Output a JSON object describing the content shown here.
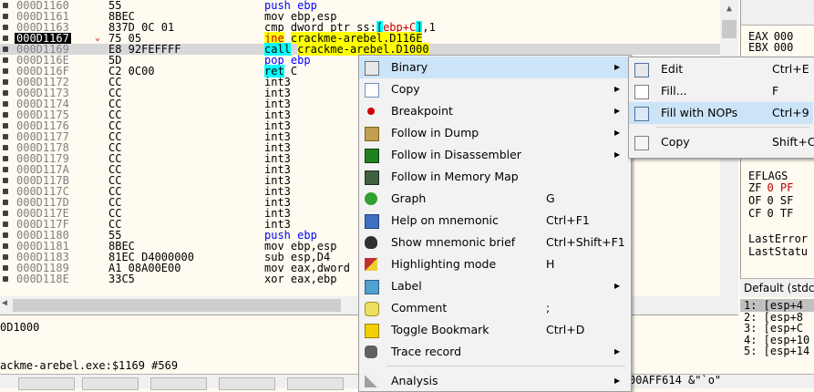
{
  "disasm": {
    "rows": [
      {
        "addr": "000D1160",
        "bytes": "55",
        "parts": [
          {
            "t": "push ebp",
            "c": "kw"
          }
        ]
      },
      {
        "addr": "000D1161",
        "bytes": "8BEC",
        "parts": [
          {
            "t": "mov ebp,esp",
            "c": ""
          }
        ]
      },
      {
        "addr": "000D1163",
        "bytes": "837D 0C 01",
        "parts": [
          {
            "t": "cmp dword ptr ss:",
            "c": ""
          },
          {
            "t": "[",
            "c": "hl-c"
          },
          {
            "t": "ebp+C",
            "c": "jmp-red"
          },
          {
            "t": "]",
            "c": "hl-c"
          },
          {
            "t": ",1",
            "c": ""
          }
        ]
      },
      {
        "addr": "000D1167",
        "bytes": "75 05",
        "parts": [
          {
            "t": "jne",
            "c": "hl-y jmp-red"
          },
          {
            "t": " ",
            "c": ""
          },
          {
            "t": "crackme-arebel.D116E",
            "c": "hl-y"
          }
        ],
        "cur": true,
        "arrow": "⌄"
      },
      {
        "addr": "000D1169",
        "bytes": "E8 92FEFFFF",
        "parts": [
          {
            "t": "call",
            "c": "hl-c"
          },
          {
            "t": " ",
            "c": ""
          },
          {
            "t": "crackme-arebel.D1000",
            "c": "hl-y"
          }
        ],
        "sel": true
      },
      {
        "addr": "000D116E",
        "bytes": "5D",
        "parts": [
          {
            "t": "pop ebp",
            "c": "kw"
          }
        ]
      },
      {
        "addr": "000D116F",
        "bytes": "C2 0C00",
        "parts": [
          {
            "t": "ret",
            "c": "hl-c"
          },
          {
            "t": " C",
            "c": ""
          }
        ]
      },
      {
        "addr": "000D1172",
        "bytes": "CC",
        "parts": [
          {
            "t": "int3",
            "c": ""
          }
        ]
      },
      {
        "addr": "000D1173",
        "bytes": "CC",
        "parts": [
          {
            "t": "int3",
            "c": ""
          }
        ]
      },
      {
        "addr": "000D1174",
        "bytes": "CC",
        "parts": [
          {
            "t": "int3",
            "c": ""
          }
        ]
      },
      {
        "addr": "000D1175",
        "bytes": "CC",
        "parts": [
          {
            "t": "int3",
            "c": ""
          }
        ]
      },
      {
        "addr": "000D1176",
        "bytes": "CC",
        "parts": [
          {
            "t": "int3",
            "c": ""
          }
        ]
      },
      {
        "addr": "000D1177",
        "bytes": "CC",
        "parts": [
          {
            "t": "int3",
            "c": ""
          }
        ]
      },
      {
        "addr": "000D1178",
        "bytes": "CC",
        "parts": [
          {
            "t": "int3",
            "c": ""
          }
        ]
      },
      {
        "addr": "000D1179",
        "bytes": "CC",
        "parts": [
          {
            "t": "int3",
            "c": ""
          }
        ]
      },
      {
        "addr": "000D117A",
        "bytes": "CC",
        "parts": [
          {
            "t": "int3",
            "c": ""
          }
        ]
      },
      {
        "addr": "000D117B",
        "bytes": "CC",
        "parts": [
          {
            "t": "int3",
            "c": ""
          }
        ]
      },
      {
        "addr": "000D117C",
        "bytes": "CC",
        "parts": [
          {
            "t": "int3",
            "c": ""
          }
        ]
      },
      {
        "addr": "000D117D",
        "bytes": "CC",
        "parts": [
          {
            "t": "int3",
            "c": ""
          }
        ]
      },
      {
        "addr": "000D117E",
        "bytes": "CC",
        "parts": [
          {
            "t": "int3",
            "c": ""
          }
        ]
      },
      {
        "addr": "000D117F",
        "bytes": "CC",
        "parts": [
          {
            "t": "int3",
            "c": ""
          }
        ]
      },
      {
        "addr": "000D1180",
        "bytes": "55",
        "parts": [
          {
            "t": "push ebp",
            "c": "kw"
          }
        ]
      },
      {
        "addr": "000D1181",
        "bytes": "8BEC",
        "parts": [
          {
            "t": "mov ebp,esp",
            "c": ""
          }
        ]
      },
      {
        "addr": "000D1183",
        "bytes": "81EC D4000000",
        "parts": [
          {
            "t": "sub esp,D4",
            "c": ""
          }
        ]
      },
      {
        "addr": "000D1189",
        "bytes": "A1 08A00E00",
        "parts": [
          {
            "t": "mov eax,dword",
            "c": ""
          }
        ]
      },
      {
        "addr": "000D118E",
        "bytes": "33C5",
        "parts": [
          {
            "t": "xor eax,ebp",
            "c": ""
          }
        ]
      }
    ]
  },
  "info": {
    "line1": "0D1000",
    "line2": "ackme-arebel.exe:$1169 #569"
  },
  "registers": [
    {
      "name": "EAX",
      "val": "000"
    },
    {
      "name": "EBX",
      "val": "000"
    },
    {
      "name": "EFLAGS",
      "val": ""
    },
    {
      "name": "ZF",
      "val": "0  PF"
    },
    {
      "name": "OF",
      "val": "0  SF"
    },
    {
      "name": "CF",
      "val": "0  TF"
    },
    {
      "name": "LastError",
      "val": ""
    },
    {
      "name": "LastStatu",
      "val": ""
    }
  ],
  "stack": {
    "header": "Default (stdca",
    "rows": [
      "1: [esp+4",
      "2: [esp+8",
      "3: [esp+C",
      "4: [esp+10",
      "5: [esp+14"
    ]
  },
  "statusbar": {
    "text": "00AFF614  &\"`o\""
  },
  "context_menu": {
    "items": [
      {
        "label": "Binary",
        "shortcut": "",
        "sub": true,
        "icon": "binary-icon",
        "hov": true
      },
      {
        "label": "Copy",
        "shortcut": "",
        "sub": true,
        "icon": "copy-icon"
      },
      {
        "label": "Breakpoint",
        "shortcut": "",
        "sub": true,
        "icon": "breakpoint-icon"
      },
      {
        "label": "Follow in Dump",
        "shortcut": "",
        "sub": true,
        "icon": "dump-icon"
      },
      {
        "label": "Follow in Disassembler",
        "shortcut": "",
        "sub": true,
        "icon": "cpu-icon"
      },
      {
        "label": "Follow in Memory Map",
        "shortcut": "",
        "sub": false,
        "icon": "memory-map-icon"
      },
      {
        "label": "Graph",
        "shortcut": "G",
        "sub": false,
        "icon": "graph-icon"
      },
      {
        "label": "Help on mnemonic",
        "shortcut": "Ctrl+F1",
        "sub": false,
        "icon": "help-icon"
      },
      {
        "label": "Show mnemonic brief",
        "shortcut": "Ctrl+Shift+F1",
        "sub": false,
        "icon": "penguin-icon"
      },
      {
        "label": "Highlighting mode",
        "shortcut": "H",
        "sub": false,
        "icon": "highlight-icon"
      },
      {
        "label": "Label",
        "shortcut": "",
        "sub": true,
        "icon": "label-icon"
      },
      {
        "label": "Comment",
        "shortcut": ";",
        "sub": false,
        "icon": "comment-icon"
      },
      {
        "label": "Toggle Bookmark",
        "shortcut": "Ctrl+D",
        "sub": false,
        "icon": "bookmark-icon"
      },
      {
        "label": "Trace record",
        "shortcut": "",
        "sub": true,
        "icon": "trace-icon"
      },
      {
        "label": "Analysis",
        "shortcut": "",
        "sub": true,
        "icon": "analysis-icon"
      }
    ]
  },
  "binary_submenu": {
    "items": [
      {
        "label": "Edit",
        "shortcut": "Ctrl+E",
        "icon": "edit-icon"
      },
      {
        "label": "Fill...",
        "shortcut": "F",
        "icon": "fill-icon"
      },
      {
        "label": "Fill with NOPs",
        "shortcut": "Ctrl+9",
        "icon": "nop-icon",
        "hov": true
      },
      {
        "label": "Copy",
        "shortcut": "Shift+C",
        "icon": "binary-copy-icon"
      }
    ]
  }
}
